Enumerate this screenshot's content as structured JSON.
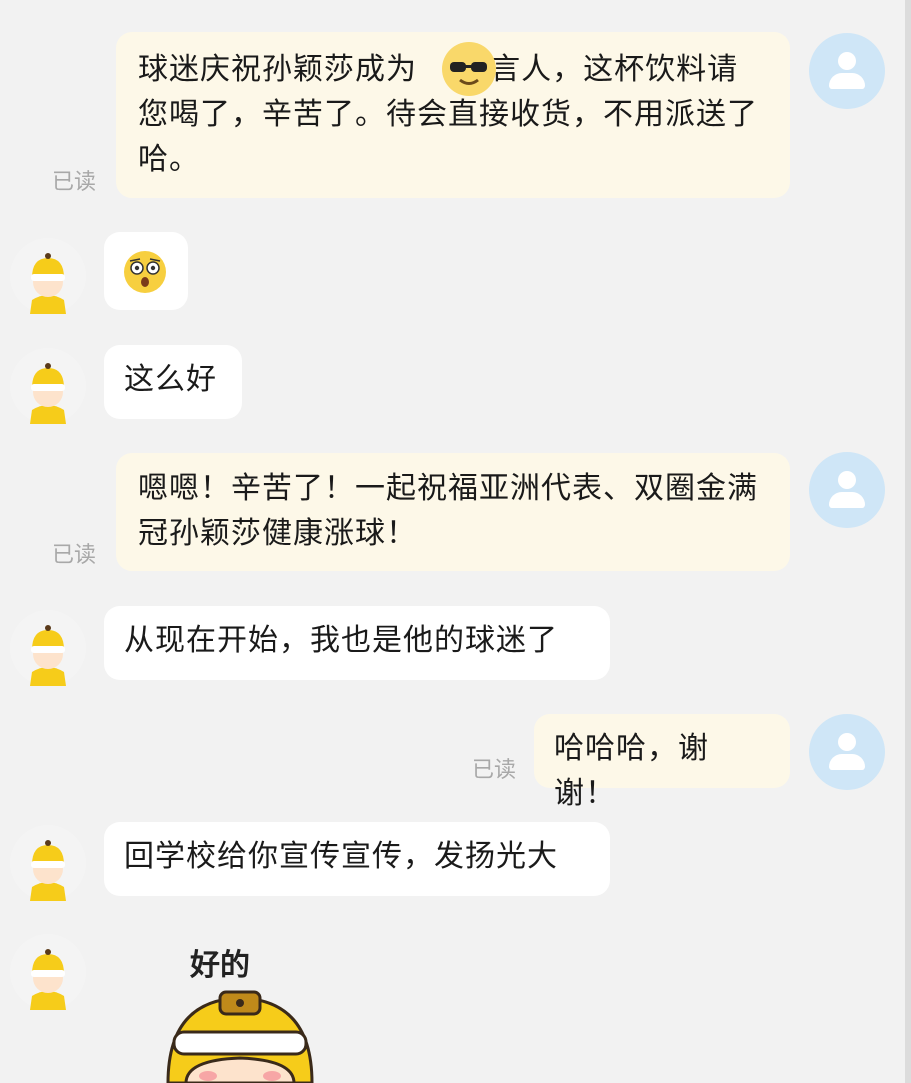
{
  "read_label": "已读",
  "messages": [
    {
      "text": "球迷庆祝孙颖莎成为    代言人，这杯饮料请您喝了，辛苦了。待会直接收货，不用派送了哈。"
    },
    {
      "emoji": "surprised-face"
    },
    {
      "text": "这么好"
    },
    {
      "text": "嗯嗯！辛苦了！一起祝福亚洲代表、双圈金满冠孙颖莎健康涨球！"
    },
    {
      "text": "从现在开始，我也是他的球迷了"
    },
    {
      "text": "哈哈哈，谢谢！"
    },
    {
      "text": "回学校给你宣传宣传，发扬光大"
    },
    {
      "sticker_caption": "好的"
    }
  ],
  "colors": {
    "outgoing_bubble": "#fdf8e8",
    "incoming_bubble": "#ffffff",
    "self_avatar": "#cfe6f7",
    "rider_helmet": "#f6cc1a",
    "background": "#f2f2f2"
  }
}
